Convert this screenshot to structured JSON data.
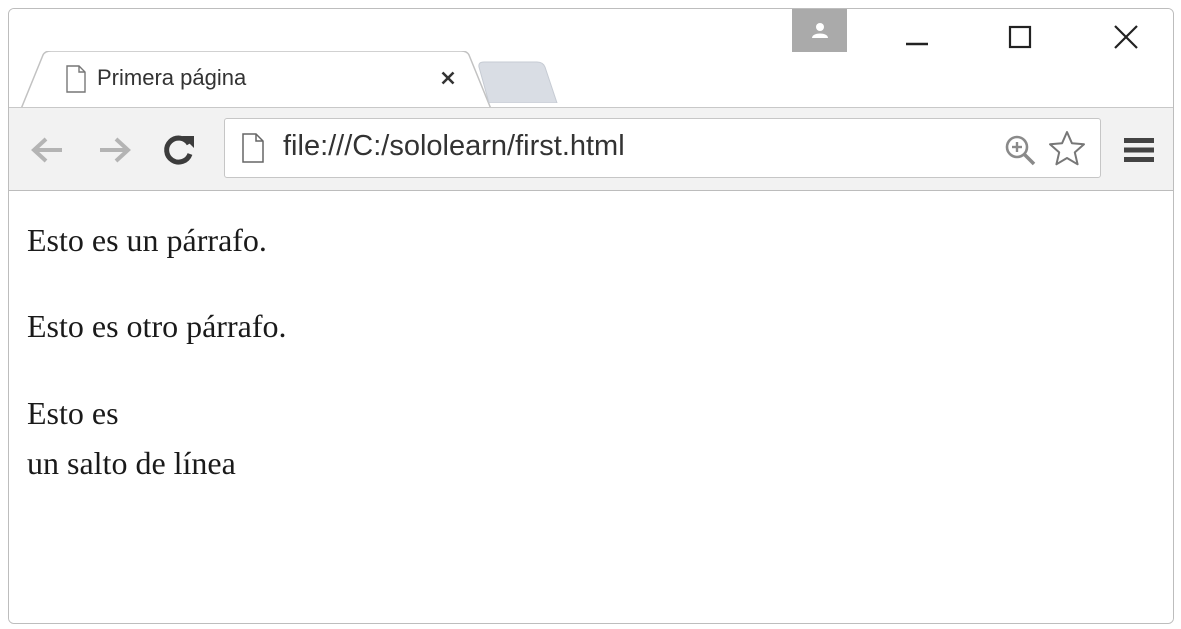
{
  "browser": {
    "tab": {
      "title": "Primera página",
      "favicon": "page-icon",
      "close_icon": "close-icon"
    },
    "new_tab_icon": "new-tab-icon",
    "profile_icon": "person-icon",
    "window_controls": {
      "minimize_icon": "minimize-icon",
      "maximize_icon": "maximize-icon",
      "close_icon": "close-icon"
    },
    "toolbar": {
      "back_icon": "back-arrow-icon",
      "forward_icon": "forward-arrow-icon",
      "reload_icon": "reload-icon",
      "menu_icon": "hamburger-menu-icon"
    },
    "omnibox": {
      "url": "file:///C:/sololearn/first.html",
      "page_icon": "page-icon",
      "zoom_icon": "zoom-in-icon",
      "bookmark_icon": "star-icon"
    }
  },
  "content": {
    "paragraph_1": "Esto es un párrafo.",
    "paragraph_2": "Esto es otro párrafo.",
    "paragraph_3": {
      "line_1": "Esto es",
      "line_2": "un salto de línea"
    }
  },
  "colors": {
    "toolbar_bg": "#f2f2f2",
    "profile_bg": "#aaaaaa",
    "icon_gray": "#b4b4b4",
    "icon_dark": "#444444",
    "text": "#1a1a1a"
  }
}
